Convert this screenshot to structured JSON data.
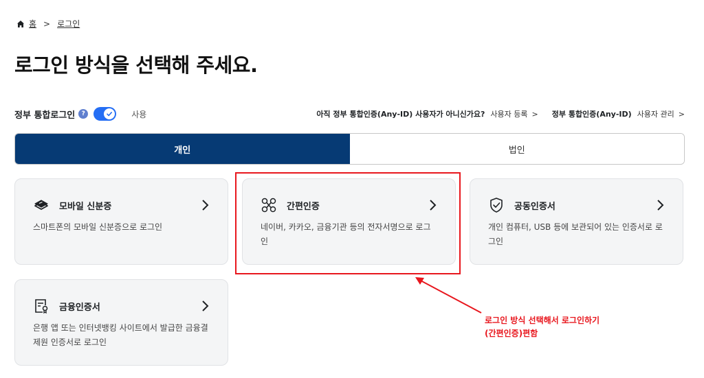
{
  "breadcrumb": {
    "home": "홈",
    "separator": ">",
    "current": "로그인"
  },
  "title": "로그인 방식을 선택해 주세요.",
  "gov_login": {
    "label": "정부 통합로그인",
    "help": "?",
    "toggle_state": "사용",
    "question": "아직 정부 통합인증(Any-ID) 사용자가 아니신가요?",
    "register_link": "사용자 등록",
    "anyid_label": "정부 통합인증(Any-ID)",
    "manage_link": "사용자 관리",
    "chevron": ">"
  },
  "tabs": [
    {
      "label": "개인",
      "active": true
    },
    {
      "label": "법인",
      "active": false
    }
  ],
  "cards": [
    {
      "title": "모바일 신분증",
      "desc": "스마트폰의 모바일 신분증으로 로그인",
      "icon": "mobile-id-icon"
    },
    {
      "title": "간편인증",
      "desc": "네이버, 카카오, 금융기관 등의 전자서명으로 로그인",
      "icon": "simple-auth-icon"
    },
    {
      "title": "공동인증서",
      "desc": "개인 컴퓨터, USB 등에 보관되어 있는 인증서로 로그인",
      "icon": "shield-check-icon"
    },
    {
      "title": "금융인증서",
      "desc": "은행 앱 또는 인터넷뱅킹 사이트에서 발급한 금융결제원 인증서로 로그인",
      "icon": "certificate-icon"
    }
  ],
  "annotation": {
    "line1": "로그인 방식 선택해서 로그인하기",
    "line2": "(간편인증)편함"
  },
  "colors": {
    "primary": "#063a74",
    "toggle": "#256ef4",
    "highlight": "#e8161d"
  }
}
